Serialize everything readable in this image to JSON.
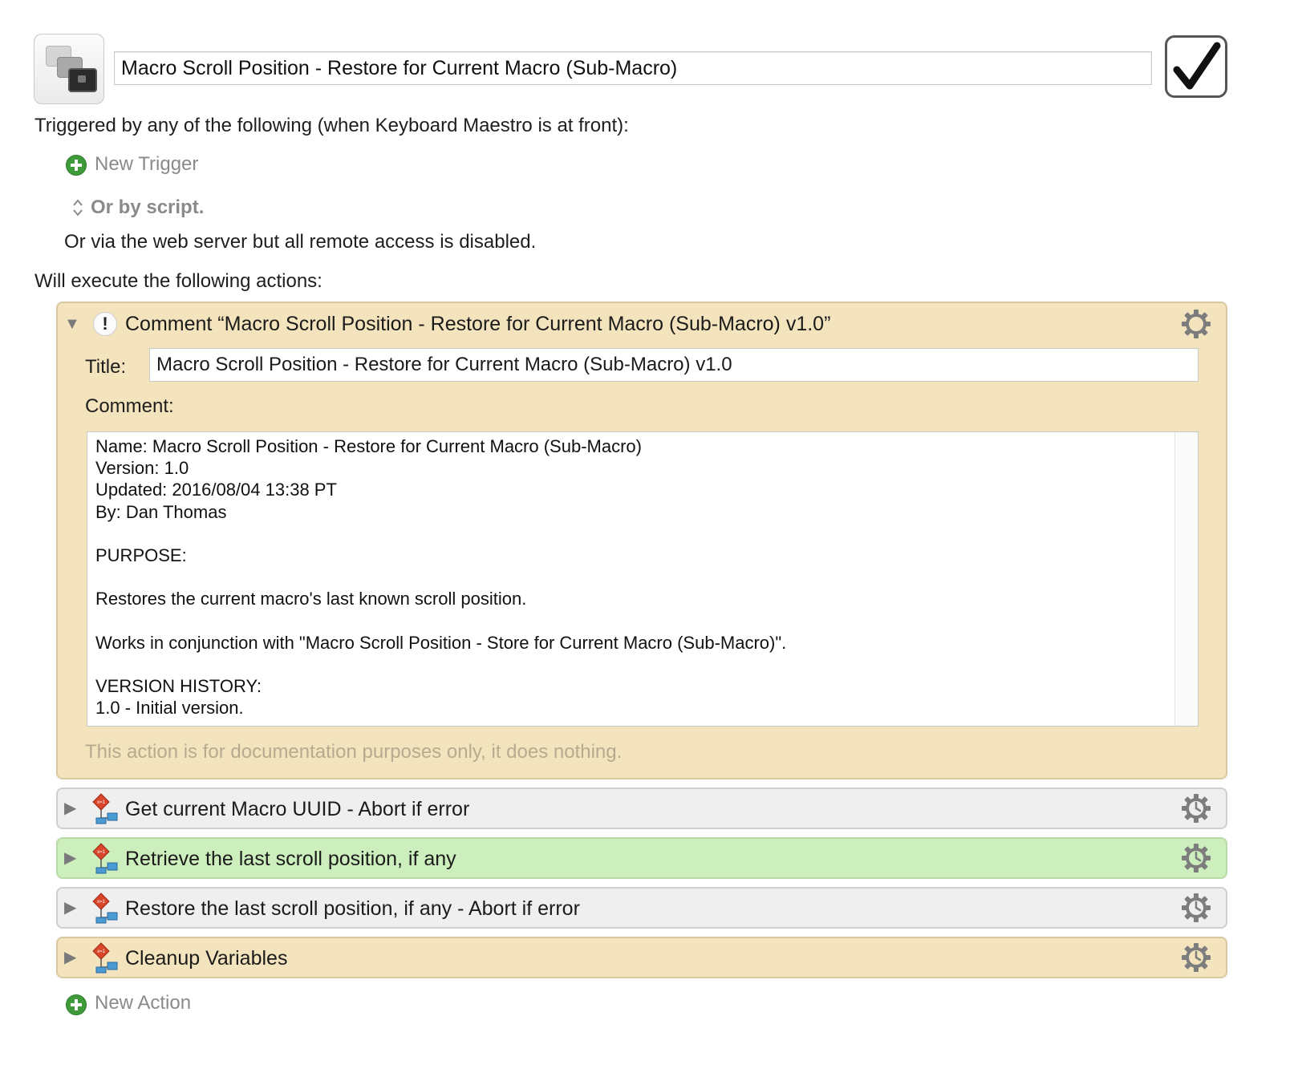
{
  "macro": {
    "name": "Macro Scroll Position - Restore for Current Macro (Sub-Macro)",
    "enabled": true
  },
  "triggers": {
    "heading": "Triggered by any of the following (when Keyboard Maestro is at front):",
    "new_trigger_label": "New Trigger",
    "or_by_script": "Or by script.",
    "web_server_note": "Or via the web server but all remote access is disabled."
  },
  "actions_heading": "Will execute the following actions:",
  "comment_action": {
    "header": "Comment “Macro Scroll Position - Restore for Current Macro (Sub-Macro) v1.0”",
    "title_label": "Title:",
    "title_value": "Macro Scroll Position - Restore for Current Macro (Sub-Macro) v1.0",
    "comment_label": "Comment:",
    "comment_text": "Name: Macro Scroll Position - Restore for Current Macro (Sub-Macro)\nVersion: 1.0\nUpdated: 2016/08/04 13:38 PT\nBy: Dan Thomas\n\nPURPOSE:\n\nRestores the current macro's last known scroll position.\n\nWorks in conjunction with \"Macro Scroll Position - Store for Current Macro (Sub-Macro)\".\n\nVERSION HISTORY:\n1.0 - Initial version.",
    "doc_note": "This action is for documentation purposes only, it does nothing."
  },
  "group_actions": [
    {
      "title": "Get current Macro UUID - Abort if error",
      "color": "#efefef"
    },
    {
      "title": "Retrieve the last scroll position, if any",
      "color": "#cdeebd"
    },
    {
      "title": "Restore the last scroll position, if any - Abort if error",
      "color": "#efefef"
    },
    {
      "title": "Cleanup Variables",
      "color": "#f3e4bd"
    }
  ],
  "new_action_label": "New Action",
  "icons": {
    "macro": "macro-windows-icon",
    "enabled": "checkbox-checked-icon",
    "add": "plus-circle-icon",
    "comment": "exclamation-icon",
    "group": "variable-group-icon",
    "gear": "gear-icon",
    "disclosure_open": "triangle-down-icon",
    "disclosure_closed": "triangle-right-icon"
  }
}
